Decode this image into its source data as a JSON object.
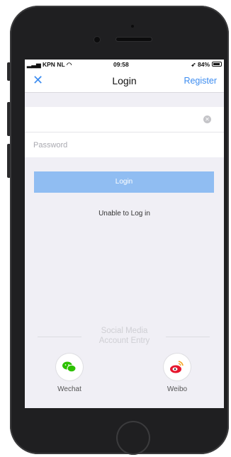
{
  "status_bar": {
    "carrier": "KPN NL",
    "time": "09:58",
    "battery": "84%"
  },
  "nav": {
    "title": "Login",
    "register": "Register"
  },
  "form": {
    "username_value": "",
    "username_placeholder": "",
    "password_placeholder": "Password",
    "login_label": "Login",
    "unable_label": "Unable to Log in"
  },
  "social": {
    "title_line1": "Social Media",
    "title_line2": "Account Entry",
    "providers": [
      {
        "label": "Wechat",
        "icon": "wechat-icon",
        "color": "#2dc100"
      },
      {
        "label": "Weibo",
        "icon": "weibo-icon",
        "color": "#e6162d"
      }
    ]
  },
  "colors": {
    "accent": "#3c8cf0",
    "button": "#90bdf2"
  }
}
